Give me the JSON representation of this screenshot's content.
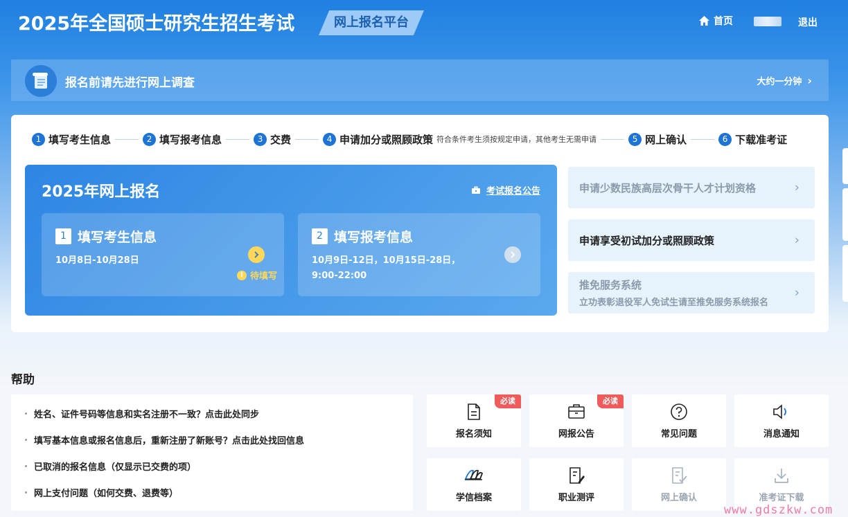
{
  "header": {
    "title": "2025年全国硕士研究生招生考试",
    "platform": "网上报名平台",
    "home": "首页",
    "logout": "退出"
  },
  "survey": {
    "text": "报名前请先进行网上调查",
    "time": "大约一分钟"
  },
  "steps": [
    {
      "num": "1",
      "label": "填写考生信息"
    },
    {
      "num": "2",
      "label": "填写报考信息"
    },
    {
      "num": "3",
      "label": "交费"
    },
    {
      "num": "4",
      "label": "申请加分或照顾政策",
      "note": "符合条件考生须按规定申请，其他考生无需申请"
    },
    {
      "num": "5",
      "label": "网上确认"
    },
    {
      "num": "6",
      "label": "下载准考证"
    }
  ],
  "registration": {
    "title": "2025年网上报名",
    "notice": "考试报名公告",
    "cards": [
      {
        "num": "1",
        "title": "填写考生信息",
        "date": "10月8日-10月28日",
        "status": "待填写"
      },
      {
        "num": "2",
        "title": "填写报考信息",
        "date": "10月9日-12日，10月15日-28日，9:00-22:00"
      }
    ]
  },
  "side_options": [
    {
      "label": "申请少数民族高层次骨干人才计划资格"
    },
    {
      "label": "申请享受初试加分或照顾政策"
    },
    {
      "label": "推免服务系统",
      "sub": "立功表彰退役军人免试生请至推免服务系统报名"
    }
  ],
  "help": {
    "heading": "帮助",
    "items": [
      "姓名、证件号码等信息和实名注册不一致？点击此处同步",
      "填写基本信息或报名信息后，重新注册了新账号？点击此处找回信息",
      "已取消的报名信息（仅显示已交费的项）",
      "网上支付问题（如何交费、退费等）"
    ]
  },
  "tiles": [
    {
      "label": "报名须知",
      "badge": "必读",
      "icon": "document-icon"
    },
    {
      "label": "网报公告",
      "badge": "必读",
      "icon": "briefcase-icon"
    },
    {
      "label": "常见问题",
      "icon": "question-icon"
    },
    {
      "label": "消息通知",
      "icon": "speaker-icon"
    },
    {
      "label": "学信档案",
      "icon": "book-icon"
    },
    {
      "label": "职业测评",
      "icon": "edit-document-icon"
    },
    {
      "label": "网上确认",
      "icon": "check-document-icon"
    },
    {
      "label": "准考证下载",
      "icon": "download-icon"
    }
  ],
  "watermark": "www.gdszkw.com",
  "colors": {
    "primary": "#1e73d6",
    "badge": "#ef5a5a",
    "pending": "#ffd85a"
  }
}
